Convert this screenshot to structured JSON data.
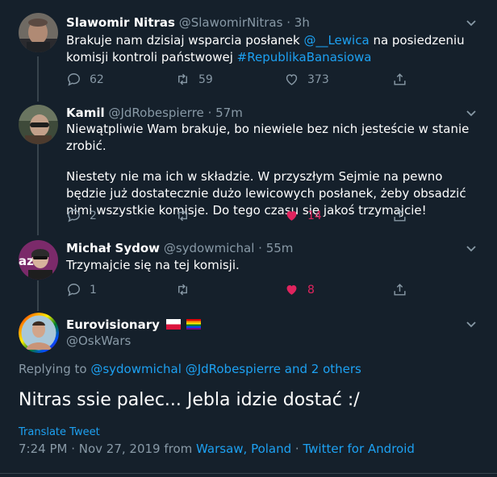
{
  "tweets": [
    {
      "name": "Slawomir Nitras",
      "handle": "@SlawomirNitras",
      "dot": "·",
      "time": "3h",
      "text_parts": [
        "Brakuje nam dzisiaj wsparcia posłanek ",
        "@__Lewica",
        " na posiedzeniu komisji kontroli państwowej ",
        "#RepublikaBanasiowa"
      ],
      "replies": "62",
      "retweets": "59",
      "likes": "373"
    },
    {
      "name": "Kamil",
      "handle": "@JdRobespierre",
      "dot": "·",
      "time": "57m",
      "text_p1": "Niewątpliwie Wam brakuje, bo niewiele bez nich jesteście w stanie zrobić.",
      "text_p2": "Niestety nie ma ich w składzie. W przyszłym Sejmie na pewno będzie już dostatecznie dużo lewicowych posłanek, żeby obsadzić nimi wszystkie komisje. Do tego czasu się jakoś trzymajcie!",
      "replies": "2",
      "retweets": "",
      "likes": "14"
    },
    {
      "name": "Michał Sydow",
      "handle": "@sydowmichal",
      "dot": "·",
      "time": "55m",
      "text": "Trzymajcie się na tej komisji.",
      "replies": "1",
      "retweets": "",
      "likes": "8"
    }
  ],
  "main": {
    "name": "Eurovisionary",
    "handle": "@OskWars",
    "replying_prefix": "Replying to ",
    "replying_users": [
      "@sydowmichal",
      "@JdRobespierre"
    ],
    "replying_and": " and ",
    "replying_others": "2 others",
    "text": "Nitras ssie palec... Jebla idzie dostać :/",
    "translate": "Translate Tweet",
    "datetime": "7:24 PM · Nov 27, 2019 from ",
    "location": "Warsaw, Poland",
    "dot": " · ",
    "source": "Twitter for Android"
  },
  "colors": {
    "background": "#15202b",
    "accent": "#1da1f2",
    "muted": "#8899a6",
    "like": "#e0245e",
    "divider": "#38444d"
  },
  "icons": [
    "chevron-down-icon",
    "reply-icon",
    "retweet-icon",
    "like-icon",
    "share-icon",
    "poland-flag-icon",
    "rainbow-flag-icon"
  ]
}
